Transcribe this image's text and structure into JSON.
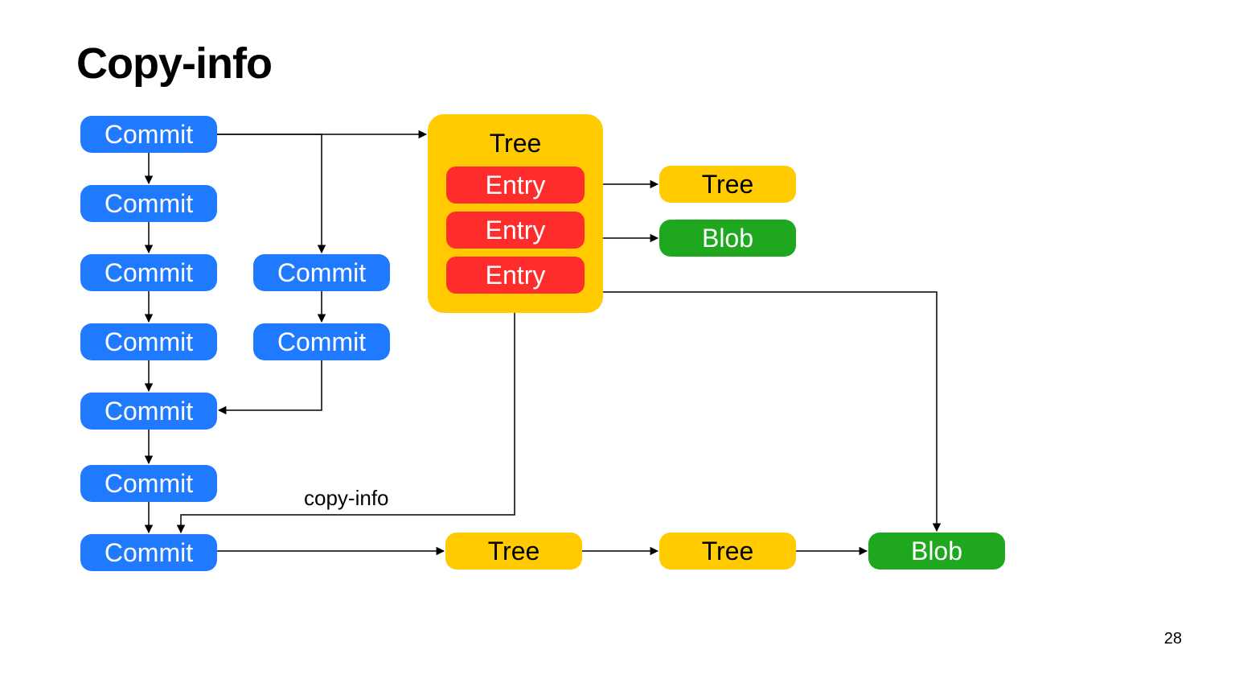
{
  "title": "Copy-info",
  "page_number": "28",
  "labels": {
    "commit": "Commit",
    "tree": "Tree",
    "entry": "Entry",
    "blob": "Blob",
    "copy_info": "copy-info"
  },
  "colors": {
    "commit": "#1f7aff",
    "tree": "#ffcb00",
    "entry": "#ff2c2c",
    "blob": "#1fa81f"
  },
  "nodes": {
    "commits_left": [
      {
        "id": "c1"
      },
      {
        "id": "c2"
      },
      {
        "id": "c3"
      },
      {
        "id": "c4"
      },
      {
        "id": "c5_merge"
      },
      {
        "id": "c6"
      },
      {
        "id": "c7"
      }
    ],
    "commits_right_branch": [
      {
        "id": "cb1"
      },
      {
        "id": "cb2"
      }
    ],
    "big_tree_entries": [
      1,
      2,
      3
    ],
    "right_top_tree": true,
    "right_top_blob": true,
    "bottom_tree_1": true,
    "bottom_tree_2": true,
    "bottom_blob": true
  },
  "edges_comment": "Arrows: c1→c2→c3→c4→c5→c6→c7 (main chain), c1→cb1→cb2→c5 (branch merge), c1→BigTree, Entry1→TreeSmTop, Entry2→BlobTop, Entry3→BlobBottom (via long line) and Entry3→copy-info→c7, c7→TreeBottom1→TreeBottom2→BlobBottom"
}
